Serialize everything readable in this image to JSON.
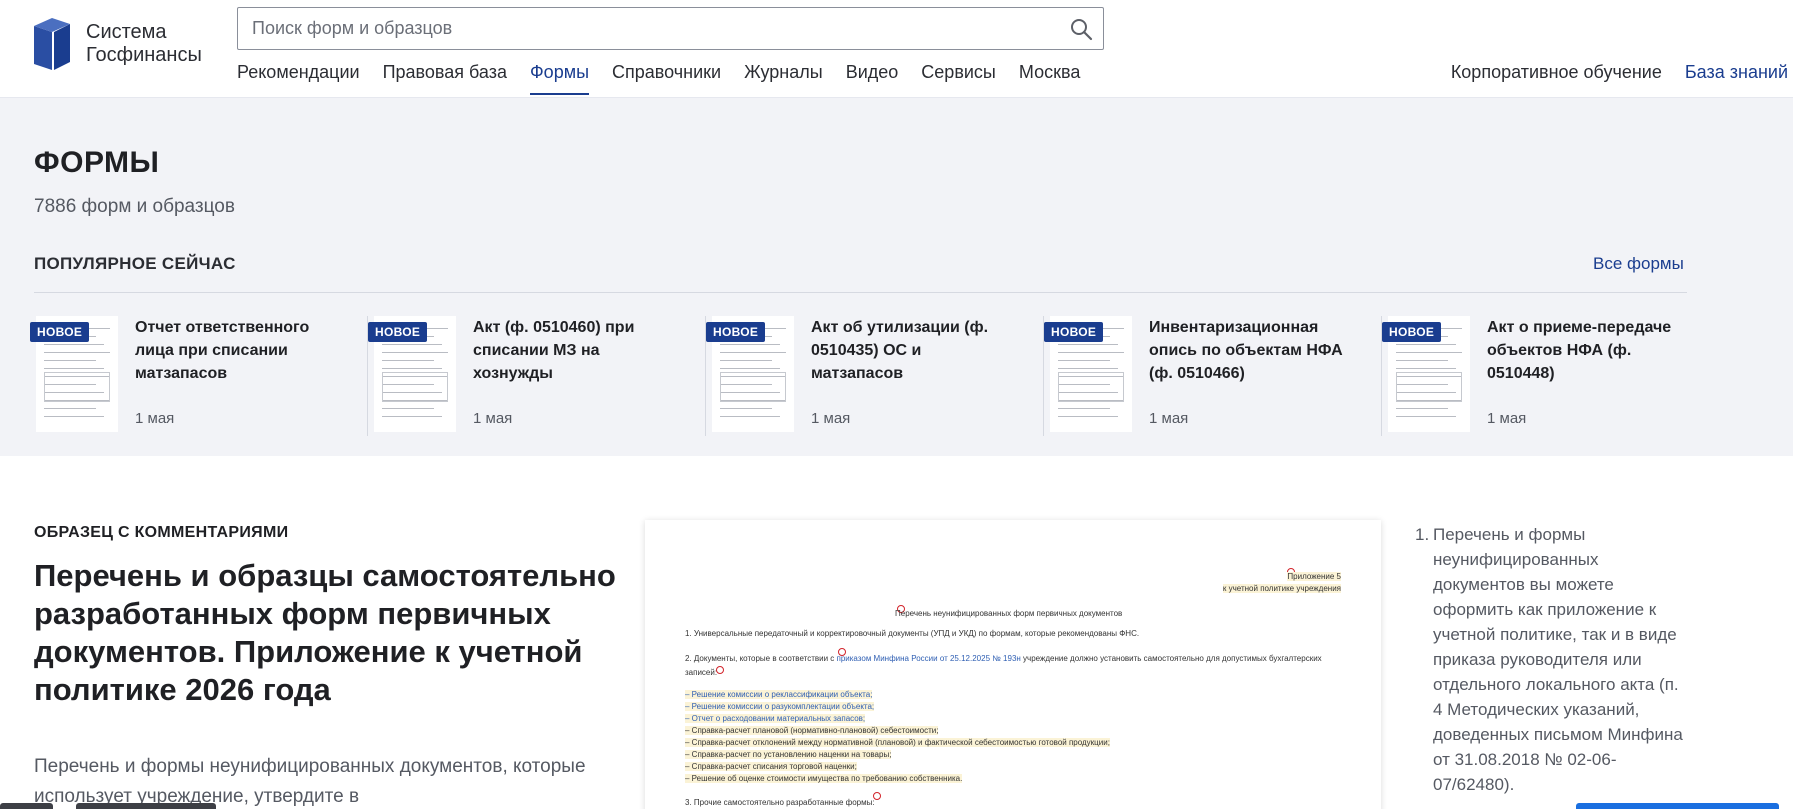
{
  "header": {
    "logo_line1": "Система",
    "logo_line2": "Госфинансы",
    "search_placeholder": "Поиск форм и образцов",
    "nav": [
      "Рекомендации",
      "Правовая база",
      "Формы",
      "Справочники",
      "Журналы",
      "Видео",
      "Сервисы",
      "Москва"
    ],
    "active_nav": "Формы",
    "corp_learning": "Корпоративное обучение",
    "knowledge_base": "База знаний",
    "accent_color": "#1a3d8f"
  },
  "forms": {
    "title": "ФОРМЫ",
    "count": "7886 форм и образцов",
    "popular_label": "ПОПУЛЯРНОЕ СЕЙЧАС",
    "all_forms": "Все формы",
    "cards": [
      {
        "badge": "НОВОЕ",
        "title": "Отчет ответственного лица при списании матзапасов",
        "date": "1 мая"
      },
      {
        "badge": "НОВОЕ",
        "title": "Акт (ф. 0510460) при списании МЗ на хознужды",
        "date": "1 мая"
      },
      {
        "badge": "НОВОЕ",
        "title": "Акт об утилизации (ф. 0510435) ОС и матзапасов",
        "date": "1 мая"
      },
      {
        "badge": "НОВОЕ",
        "title": "Инвентаризационная опись по объектам НФА (ф. 0510466)",
        "date": "1 мая"
      },
      {
        "badge": "НОВОЕ",
        "title": "Акт о приеме-передаче объектов НФА (ф. 0510448)",
        "date": "1 мая"
      }
    ]
  },
  "sample": {
    "label": "ОБРАЗЕЦ С КОММЕНТАРИЯМИ",
    "title": "Перечень и образцы самостоятельно разработанных форм первичных документов. Приложение к учетной политике 2026 года",
    "desc": "Перечень и формы неунифицированных документов, которые использует учреждение, утвердите в",
    "doc": {
      "appendix1": "Приложение 5",
      "appendix2": "к учетной политике учреждения",
      "heading": "Перечень неунифицированных форм первичных документов",
      "p1": "1. Универсальные передаточный и корректировочный документы (УПД и УКД) по формам, которые рекомендованы ФНС.",
      "p2a": "2. Документы, которые в соответствии с ",
      "p2link": "приказом Минфина России от 25.12.2025 № 193н",
      "p2b": " учреждение должно установить самостоятельно для допустимых бухгалтерских",
      "p2c": "записей:",
      "items": [
        "– Решение комиссии о реклассификации объекта;",
        "– Решение комиссии о разукомплектации объекта;",
        "– Отчет о расходовании материальных запасов;",
        "– Справка-расчет плановой (нормативно-плановой) себестоимости;",
        "– Справка-расчет отклонений между нормативной (плановой) и фактической себестоимостью готовой продукции;",
        "– Справка-расчет по установлению наценки на товары;",
        "– Справка-расчет списания торговой наценки;",
        "– Решение об оценке стоимости имущества по требованию собственника."
      ],
      "p3": "3. Прочие самостоятельно разработанные формы:"
    },
    "side_num": "1.",
    "side_text": "Перечень и формы неунифицированных документов вы можете оформить как приложение к учетной политике, так и в виде приказа руководителя или отдельного локального акта (п. 4 Методических указаний, доведенных письмом Минфина от 31.08.2018 № 02-06-07/62480)."
  }
}
